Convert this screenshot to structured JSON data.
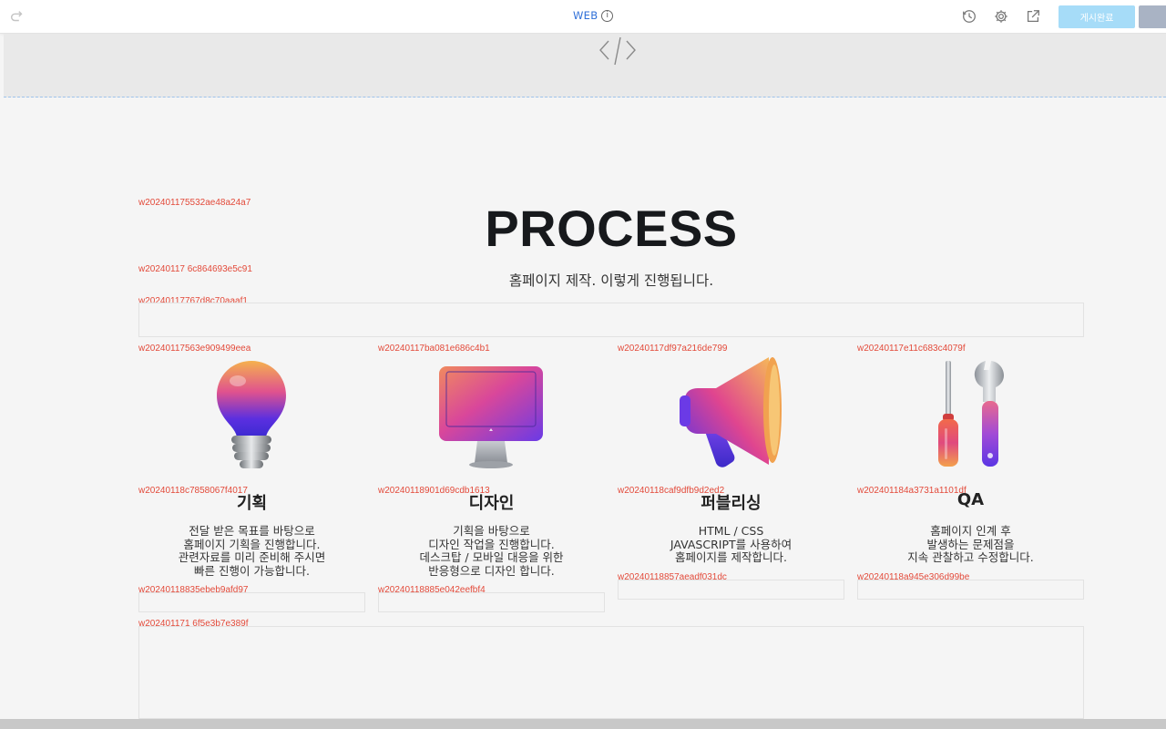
{
  "toolbar": {
    "mode_label": "WEB",
    "publish_label": "게시완료"
  },
  "section": {
    "title": "PROCESS",
    "subtitle": "홈페이지 제작. 이렇게 진행됩니다."
  },
  "widget_ids": {
    "title": "w202401175532ae48a24a7",
    "subtitle": "w20240117 6c864693e5c91",
    "spacer_top": "w20240117767d8c70aaaf1",
    "col1_icon": "w20240117563e909499eea",
    "col2_icon": "w20240117ba081e686c4b1",
    "col3_icon": "w20240117df97a216de799",
    "col4_icon": "w20240117e11c683c4079f",
    "col1_text": "w20240118c7858067f4017",
    "col2_text": "w20240118901d69cdb1613",
    "col3_text": "w20240118caf9dfb9d2ed2",
    "col4_text": "w202401184a3731a1101df",
    "col1_spacer": "w20240118835ebeb9afd97",
    "col2_spacer": "w20240118885e042eefbf4",
    "col3_spacer": "w20240118857aeadf031dc",
    "col4_spacer": "w20240118a945e306d99be",
    "spacer_bottom": "w202401171 6f5e3b7e389f"
  },
  "steps": [
    {
      "icon": "lightbulb-icon",
      "title": "기획",
      "desc": [
        "전달 받은 목표를 바탕으로",
        "홈페이지 기획을 진행합니다.",
        "관련자료를 미리 준비해 주시면",
        "빠른 진행이 가능합니다."
      ]
    },
    {
      "icon": "monitor-icon",
      "title": "디자인",
      "desc": [
        "기획을 바탕으로",
        "디자인 작업을 진행합니다.",
        "데스크탑 / 모바일 대응을 위한",
        "반응형으로 디자인 합니다."
      ]
    },
    {
      "icon": "megaphone-icon",
      "title": "퍼블리싱",
      "desc": [
        "HTML / CSS",
        "JAVASCRIPT를 사용하여",
        "홈페이지를 제작합니다."
      ]
    },
    {
      "icon": "tools-icon",
      "title": "QA",
      "desc": [
        "홈페이지 인계 후",
        "발생하는 문제점을",
        "지속 관찰하고 수정합니다."
      ]
    }
  ],
  "colors": {
    "accent": "#2f6fd8",
    "widget_id": "#e34a3a",
    "publish_button": "#a6dcf8"
  }
}
